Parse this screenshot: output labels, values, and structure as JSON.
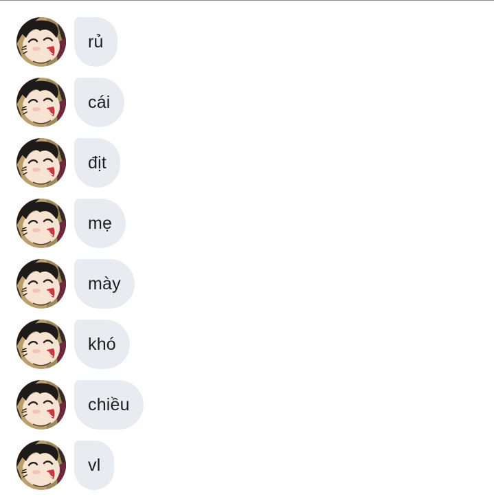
{
  "messages": [
    {
      "text": "rủ",
      "avatar_icon": "anime-boy-avatar-icon"
    },
    {
      "text": "cái",
      "avatar_icon": "anime-boy-avatar-icon"
    },
    {
      "text": "địt",
      "avatar_icon": "anime-boy-avatar-icon"
    },
    {
      "text": "mẹ",
      "avatar_icon": "anime-boy-avatar-icon"
    },
    {
      "text": "mày",
      "avatar_icon": "anime-boy-avatar-icon"
    },
    {
      "text": "khó",
      "avatar_icon": "anime-boy-avatar-icon"
    },
    {
      "text": "chiều",
      "avatar_icon": "anime-boy-avatar-icon"
    },
    {
      "text": "vl",
      "avatar_icon": "anime-boy-avatar-icon"
    }
  ],
  "colors": {
    "bubble_background": "#e8ecf1",
    "text": "#1c1e21",
    "divider": "#8a8a8a"
  }
}
